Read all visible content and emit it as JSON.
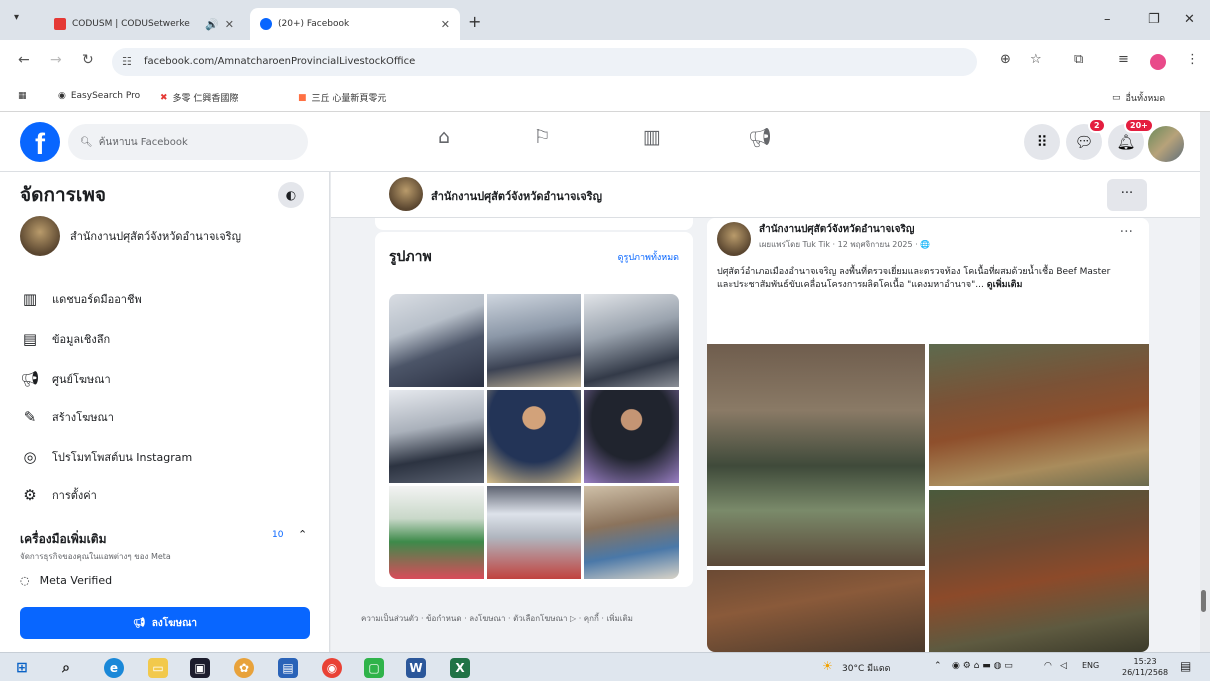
{
  "browser": {
    "tabs": [
      {
        "title": "CODUSM | CODUSetwerke",
        "favicon_color": "#e53935"
      },
      {
        "title": "(20+) Facebook",
        "favicon_color": "#0866ff"
      }
    ],
    "url": "facebook.com/AmnatcharoenProvincialLivestockOffice",
    "bookmarks": [
      {
        "label": "EasySearch Pro",
        "color": "#5a5a5a"
      },
      {
        "label": "多零 仁興香國際",
        "color": "#e53935"
      },
      {
        "label": "三丘 心量新頁零元",
        "color": "#ff7043"
      }
    ],
    "bookmarks_right": "อื่นทั้งหมด"
  },
  "fb": {
    "search_placeholder": "ค้นหาบน Facebook",
    "messenger_badge": "2",
    "notifications_badge": "20+",
    "brand_color": "#0866ff"
  },
  "sidebar": {
    "heading": "จัดการเพจ",
    "page_name": "สำนักงานปศุสัตว์จังหวัดอำนาจเจริญ",
    "items": [
      {
        "label": "แดชบอร์ดมืออาชีพ",
        "icon": "chart-icon"
      },
      {
        "label": "ข้อมูลเชิงลึก",
        "icon": "insights-icon"
      },
      {
        "label": "ศูนย์โฆษณา",
        "icon": "megaphone-icon"
      },
      {
        "label": "สร้างโฆษณา",
        "icon": "pencil-icon"
      },
      {
        "label": "โปรโมทโพสต์บน Instagram",
        "icon": "instagram-icon"
      },
      {
        "label": "การตั้งค่า",
        "icon": "gear-icon"
      }
    ],
    "more_tools_title": "เครื่องมือเพิ่มเติม",
    "more_tools_sub": "จัดการธุรกิจของคุณในแอพต่างๆ ของ Meta",
    "more_tools_count": "10",
    "more_tools_first": "Meta Verified",
    "advertise_label": "ลงโฆษณา"
  },
  "page_header": {
    "name": "สำนักงานปศุสัตว์จังหวัดอำนาจเจริญ"
  },
  "photos": {
    "title": "รูปภาพ",
    "see_all": "ดูรูปภาพทั้งหมด"
  },
  "footer_links": "ความเป็นส่วนตัว · ข้อกำหนด · ลงโฆษณา · ตัวเลือกโฆษณา ▷ · คุกกี้ · เพิ่มเติม",
  "post": {
    "author": "สำนักงานปศุสัตว์จังหวัดอำนาจเจริญ",
    "meta": "เผยแพร่โดย Tuk Tik · 12 พฤศจิกายน 2025 · 🌐",
    "text": "ปศุสัตว์อำเภอเมืองอำนาจเจริญ ลงพื้นที่ตรวจเยี่ยมและตรวจท้อง โคเนื้อที่ผสมด้วยน้ำเชื้อ Beef Master และประชาสัมพันธ์ขับเคลื่อนโครงการผลิตโคเนื้อ \"แดงมหาอำนาจ\"...",
    "see_more": "ดูเพิ่มเติม"
  },
  "taskbar": {
    "weather": "30°C มีแดด",
    "lang": "ENG",
    "time": "15:23",
    "date": "26/11/2568"
  }
}
